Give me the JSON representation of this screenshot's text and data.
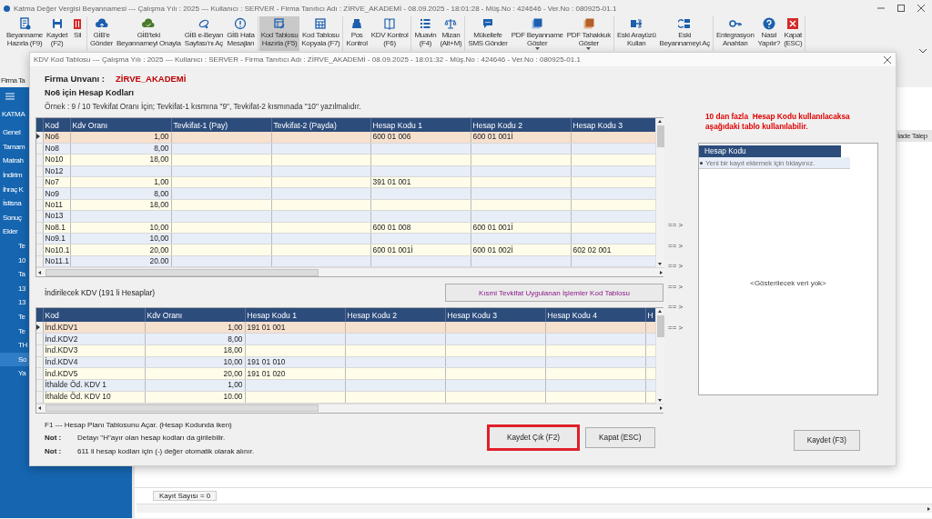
{
  "app": {
    "title": "Katma Değer Vergisi Beyannamesi  ---  Çalışma Yılı : 2025  ---  Kullanıcı : SERVER - Firma Tanıtıcı Adı : ZİRVE_AKADEMİ - 08.09.2025 - 18:01:28 - Müş.No : 424646 - Ver.No : 080925-01.1"
  },
  "toolbar": {
    "groups": [
      [
        {
          "label": "Beyanname\nHazırla (F9)",
          "selected": false
        },
        {
          "label": "Kaydet\n(F2)",
          "selected": false
        },
        {
          "label": "Sil",
          "selected": false
        }
      ],
      [
        {
          "label": "GİB'e\nGönder",
          "selected": false
        },
        {
          "label": "GİB'teki\nBeyannameyi Onayla",
          "selected": false
        },
        {
          "label": "GİB e-Beyan\nSayfası'nı Aç",
          "selected": false
        },
        {
          "label": "GİB Hata\nMesajları",
          "selected": false
        }
      ],
      [
        {
          "label": "Kod Tablosu\nHazırla (F5)",
          "selected": true
        },
        {
          "label": "Kod Tablosu\nKopyala (F7)",
          "selected": false
        }
      ],
      [
        {
          "label": "Pos\nKontrol",
          "selected": false
        },
        {
          "label": "KDV Kontrol\n(F6)",
          "selected": false
        }
      ],
      [
        {
          "label": "Muavin\n(F4)",
          "selected": false
        },
        {
          "label": "Mizan\n(Alt+M)",
          "selected": false
        }
      ],
      [
        {
          "label": "Mükellefe\nSMS Gönder",
          "selected": false
        },
        {
          "label": "PDF Beyanname\nGöster",
          "selected": false,
          "menu": true
        },
        {
          "label": "PDF Tahakkuk\nGöster",
          "selected": false,
          "menu": true
        }
      ],
      [
        {
          "label": "Eski Arayüzü\nKullan",
          "selected": false
        },
        {
          "label": "Eski\nBeyannameyi Aç",
          "selected": false
        }
      ],
      [
        {
          "label": "Entegrasyon\nAnahtarı",
          "selected": false
        },
        {
          "label": "Nasıl\nYapılır?",
          "selected": false
        },
        {
          "label": "Kapat\n(ESC)",
          "selected": false
        }
      ]
    ]
  },
  "sidebar": {
    "title": "Firma Ta",
    "heading": "KATMA",
    "items": [
      {
        "label": "Genel",
        "selected": false
      },
      {
        "label": "Tamam",
        "selected": false
      },
      {
        "label": "Matrah",
        "selected": false
      },
      {
        "label": "İndirim",
        "selected": false
      },
      {
        "label": "İhraç K",
        "selected": false
      },
      {
        "label": "İstisna",
        "selected": false
      },
      {
        "label": "Sonuç",
        "selected": false
      },
      {
        "label": "Ekler",
        "selected": false,
        "children": [
          {
            "label": "Te",
            "selected": false
          },
          {
            "label": "10",
            "selected": false
          },
          {
            "label": "Ta",
            "selected": false
          },
          {
            "label": "13",
            "selected": false
          },
          {
            "label": "13",
            "selected": false
          },
          {
            "label": "Te",
            "selected": false
          },
          {
            "label": "Te",
            "selected": false
          },
          {
            "label": "TH",
            "selected": false
          },
          {
            "label": "So",
            "selected": true
          },
          {
            "label": "Ya",
            "selected": false
          }
        ]
      }
    ]
  },
  "main": {
    "column_header": "İade Talep",
    "record_count": "Kayıt Sayısı = 0"
  },
  "dialog": {
    "title": "KDV Kod Tablosu  ---  Çalışma Yılı : 2025  ---  Kullanıcı : SERVER - Firma Tanıtıcı Adı : ZİRVE_AKADEMİ - 08.09.2025 - 18:01:32 - Müş.No : 424646 - Ver.No : 080925-01.1",
    "firm_label": "Firma Unvanı :",
    "firm_name": "ZİRVE_AKADEMİ",
    "heading": "No6 için Hesap Kodları",
    "example": "Örnek : 9 / 10 Tevkifat Oranı İçin; Tevkifat-1 kısmına \"9\", Tevkifat-2 kısmınada \"10\" yazılmalıdır.",
    "top_grid": {
      "columns": [
        "Kod",
        "Kdv Oranı",
        "Tevkifat-1 (Pay)",
        "Tevkifat-2 (Payda)",
        "Hesap Kodu 1",
        "Hesap Kodu 2",
        "Hesap Kodu 3"
      ],
      "rows": [
        {
          "cells": [
            "No6",
            "1,00",
            null,
            null,
            "600 01 006",
            "600 01 001İ",
            null
          ],
          "selected": true
        },
        {
          "cells": [
            "No8",
            "8,00",
            null,
            null,
            null,
            null,
            null
          ],
          "selected": false
        },
        {
          "cells": [
            "No10",
            "18,00",
            null,
            null,
            null,
            null,
            null
          ],
          "selected": false
        },
        {
          "cells": [
            "No12",
            null,
            null,
            null,
            null,
            null,
            null
          ],
          "selected": false
        },
        {
          "cells": [
            "No7",
            "1,00",
            null,
            null,
            "391 01 001",
            null,
            null
          ],
          "selected": false
        },
        {
          "cells": [
            "No9",
            "8,00",
            null,
            null,
            null,
            null,
            null
          ],
          "selected": false
        },
        {
          "cells": [
            "No11",
            "18,00",
            null,
            null,
            null,
            null,
            null
          ],
          "selected": false
        },
        {
          "cells": [
            "No13",
            null,
            null,
            null,
            null,
            null,
            null
          ],
          "selected": false
        },
        {
          "cells": [
            "No8.1",
            "10,00",
            null,
            null,
            "600 01 008",
            "600 01 001İ",
            null
          ],
          "selected": false
        },
        {
          "cells": [
            "No9.1",
            "10,00",
            null,
            null,
            null,
            null,
            null
          ],
          "selected": false
        },
        {
          "cells": [
            "No10.1",
            "20,00",
            null,
            null,
            "600 01 001İ",
            "600 01 002İ",
            "602 02 001"
          ],
          "selected": false
        },
        {
          "cells": [
            "No11.1",
            "20.00",
            null,
            null,
            null,
            null,
            null
          ],
          "selected": false
        }
      ]
    },
    "bottom_label": "İndirilecek KDV (191 li Hesaplar)",
    "partial_button": "Kısmi Tevkifat Uygulanan İşlemler Kod Tablosu",
    "bottom_grid": {
      "columns": [
        "Kod",
        "Kdv Oranı",
        "Hesap Kodu 1",
        "Hesap Kodu 2",
        "Hesap Kodu 3",
        "Hesap Kodu 4",
        "H"
      ],
      "rows": [
        {
          "cells": [
            "İnd.KDV1",
            "1,00",
            "191 01 001",
            null,
            null,
            null,
            null
          ],
          "selected": true
        },
        {
          "cells": [
            "İnd.KDV2",
            "8,00",
            null,
            null,
            null,
            null,
            null
          ],
          "selected": false
        },
        {
          "cells": [
            "İnd.KDV3",
            "18,00",
            null,
            null,
            null,
            null,
            null
          ],
          "selected": false
        },
        {
          "cells": [
            "İnd.KDV4",
            "10,00",
            "191 01 010",
            null,
            null,
            null,
            null
          ],
          "selected": false
        },
        {
          "cells": [
            "İnd.KDV5",
            "20,00",
            "191 01 020",
            null,
            null,
            null,
            null
          ],
          "selected": false
        },
        {
          "cells": [
            "İthalde Öd. KDV 1",
            "1,00",
            null,
            null,
            null,
            null,
            null
          ],
          "selected": false
        },
        {
          "cells": [
            "İthalde Öd. KDV 10",
            "10.00",
            null,
            null,
            null,
            null,
            null
          ],
          "selected": false
        }
      ]
    },
    "arrows": [
      "== >",
      "== >",
      "== >",
      "== >",
      "== >",
      "== >"
    ],
    "extra_note": "10 dan fazla  Hesap Kodu kullanılacaksa\naşağıdaki tablo kullanılabilir.",
    "extra_grid": {
      "column": "Hesap Kodu",
      "new_row": "Yeni bir kayıt eklemek için tıklayınız.",
      "empty": "<Gösterilecek veri yok>"
    },
    "hint": "F1 --- Hesap Planı Tablosunu Açar. (Hesap Kodunda iken)",
    "notes": [
      {
        "label": "Not :",
        "text": "Detayı \"H\"ayır olan hesap kodları da girilebilir."
      },
      {
        "label": "Not :",
        "text": "611 li hesap kodları için (-) değer otomatik olarak alınır."
      }
    ],
    "buttons": [
      {
        "label": "Kaydet Çık (F2)",
        "highlighted": true
      },
      {
        "label": "Kapat (ESC)",
        "highlighted": false
      }
    ],
    "save_button": {
      "label": "Kaydet (F3)"
    }
  }
}
